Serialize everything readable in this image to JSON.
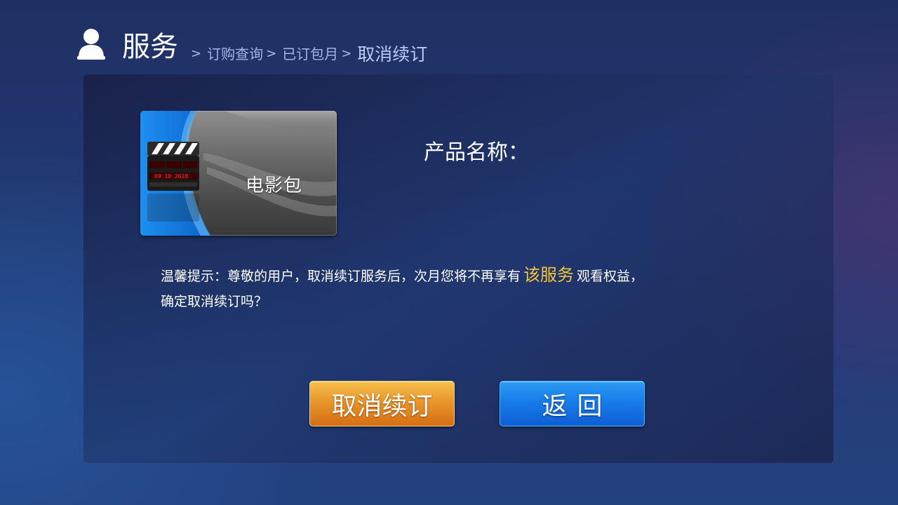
{
  "header": {
    "title": "服务",
    "icon": "user-icon",
    "breadcrumb": {
      "separator": ">",
      "items": [
        {
          "label": "订购查询"
        },
        {
          "label": "已订包月"
        },
        {
          "label": "取消续订"
        }
      ]
    }
  },
  "product": {
    "card_label": "电影包",
    "card_icon": "clapperboard-icon",
    "clapper_date": "09 10 2010",
    "name_label": "产品名称："
  },
  "notice": {
    "text_before": "温馨提示：尊敬的用户，取消续订服务后，次月您将不再享有",
    "highlight": "该服务",
    "text_after": "观看权益，",
    "line2": "确定取消续订吗？"
  },
  "buttons": {
    "cancel_renewal": "取消续订",
    "back": "返回"
  },
  "colors": {
    "highlight": "#f3c43a",
    "cancel_button": "#e8962a",
    "back_button": "#177ce8",
    "background": "#223a74"
  }
}
